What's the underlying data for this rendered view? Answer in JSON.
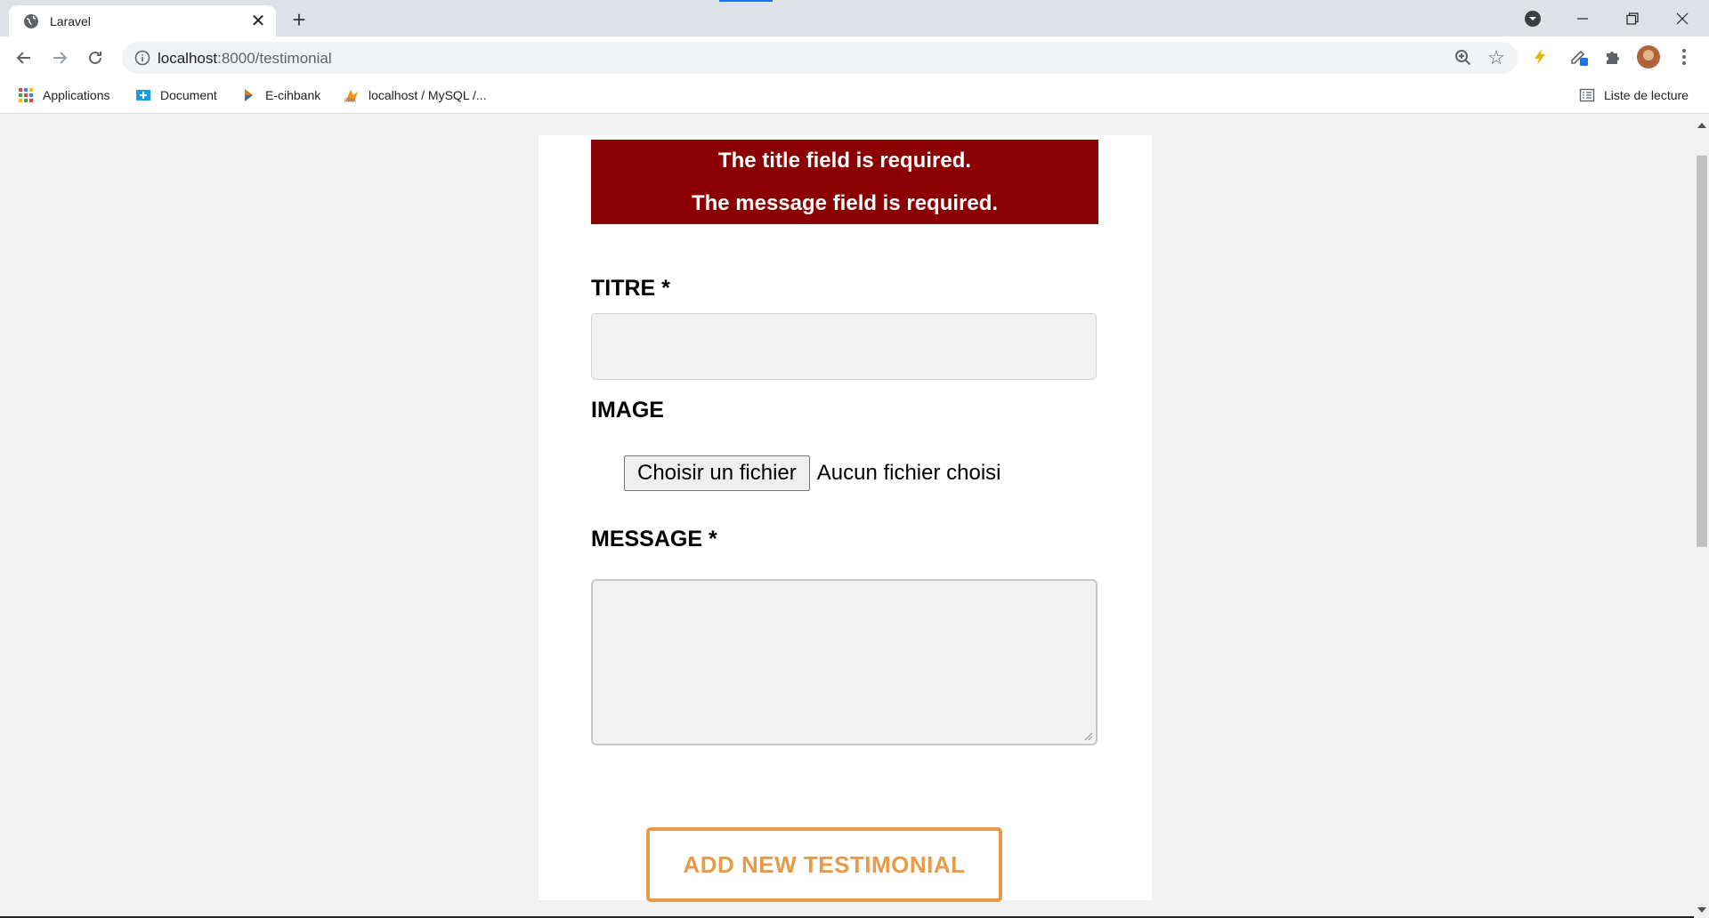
{
  "browser": {
    "tab_title": "Laravel",
    "url_host": "localhost",
    "url_rest": ":8000/testimonial",
    "bookmarks": [
      {
        "label": "Applications",
        "icon": "apps-grid-icon"
      },
      {
        "label": "Document",
        "icon": "document-bookmark-icon"
      },
      {
        "label": "E-cihbank",
        "icon": "play-bookmark-icon"
      },
      {
        "label": "localhost / MySQL /...",
        "icon": "phpmyadmin-icon"
      }
    ],
    "reading_list": "Liste de lecture"
  },
  "form": {
    "errors": [
      "The title field is required.",
      "The message field is required."
    ],
    "title_label": "TITRE *",
    "title_value": "",
    "image_label": "IMAGE",
    "file_button": "Choisir un fichier",
    "file_status": "Aucun fichier choisi",
    "message_label": "MESSAGE *",
    "message_value": "",
    "submit_label": "ADD NEW TESTIMONIAL"
  },
  "colors": {
    "error_bg": "#8b0000",
    "accent": "#e99a46"
  }
}
